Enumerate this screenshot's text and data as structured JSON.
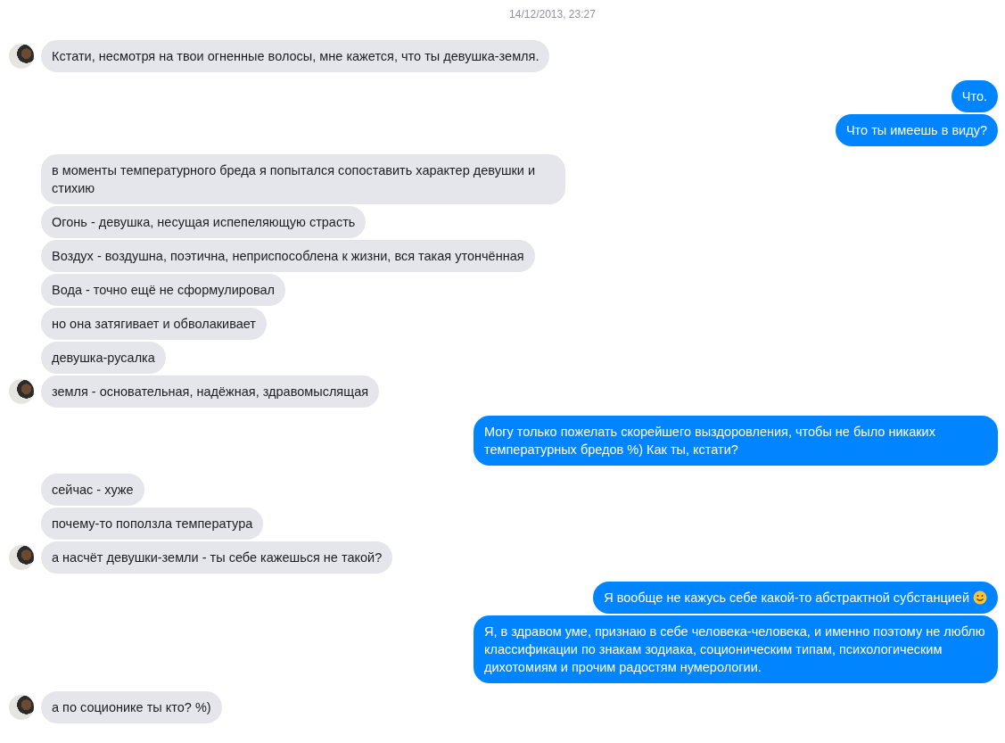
{
  "timestamp": "14/12/2013, 23:27",
  "groups": [
    {
      "kind": "incoming",
      "messages": [
        {
          "text": "Кстати, несмотря на твои огненные волосы, мне кажется, что ты девушка-земля."
        }
      ]
    },
    {
      "kind": "outgoing",
      "messages": [
        {
          "text": "Что."
        },
        {
          "text": "Что ты имеешь в виду?"
        }
      ]
    },
    {
      "kind": "incoming",
      "messages": [
        {
          "text": "в моменты температурного бреда я попытался сопоставить характер девушки и стихию"
        },
        {
          "text": "Огонь - девушка, несущая испепеляющую страсть"
        },
        {
          "text": "Воздух - воздушна, поэтична, неприспособлена к жизни, вся такая утончённая"
        },
        {
          "text": "Вода - точно ещё не сформулировал"
        },
        {
          "text": "но она затягивает и обволакивает"
        },
        {
          "text": "девушка-русалка"
        },
        {
          "text": "земля - основательная, надёжная, здравомыслящая"
        }
      ]
    },
    {
      "kind": "outgoing",
      "messages": [
        {
          "text": "Могу только пожелать скорейшего выздоровления, чтобы не было никаких температурных бредов %) Как ты, кстати?"
        }
      ]
    },
    {
      "kind": "incoming",
      "messages": [
        {
          "text": "сейчас - хуже"
        },
        {
          "text": "почему-то поползла температура"
        },
        {
          "text": "а насчёт девушки-земли - ты себе кажешься не такой?"
        }
      ]
    },
    {
      "kind": "outgoing",
      "messages": [
        {
          "text": "Я вообще не кажусь себе какой-то абстрактной субстанцией",
          "emoji": true
        },
        {
          "text": "Я, в здравом уме, признаю в себе человека-человека, и именно поэтому не люблю классификации по знакам зодиака, соционическим типам, психологическим дихотомиям и прочим радостям нумерологии."
        }
      ]
    },
    {
      "kind": "incoming",
      "messages": [
        {
          "text": "а по соционике ты кто? %)"
        }
      ]
    }
  ]
}
